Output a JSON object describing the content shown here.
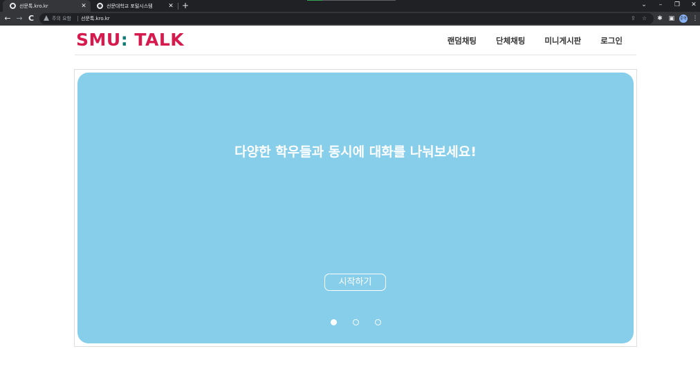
{
  "browser": {
    "tabs": [
      {
        "title": "선문톡.kro.kr",
        "active": true
      },
      {
        "title": "선문대학교 포털시스템",
        "active": false
      }
    ],
    "new_tab": "+",
    "window_controls": {
      "dropdown": "⌄",
      "minimize": "–",
      "restore": "❐",
      "close": "✕"
    },
    "tab_close": "✕",
    "nav": {
      "back": "←",
      "forward": "→",
      "reload": "C"
    },
    "address": {
      "warning": "주의 요함",
      "url": "선문톡.kro.kr"
    },
    "toolbar_icons": {
      "share": "⇪",
      "star": "☆",
      "extensions": "✱",
      "sidepanel": "▣",
      "menu": "⋮"
    },
    "profile_label": "준혁"
  },
  "header": {
    "logo_main": "SMU",
    "logo_colon": ":",
    "logo_sub": " TALK",
    "nav": [
      {
        "label": "랜덤채팅"
      },
      {
        "label": "단체채팅"
      },
      {
        "label": "미니게시판"
      },
      {
        "label": "로그인"
      }
    ]
  },
  "slider": {
    "title": "다양한 학우들과 동시에 대화를 나눠보세요!",
    "button_label": "시작하기",
    "background_color": "#87ceeb",
    "active_index": 0,
    "dot_count": 3
  },
  "colors": {
    "brand_red": "#d61a4e",
    "brand_teal": "#0f7b74"
  }
}
